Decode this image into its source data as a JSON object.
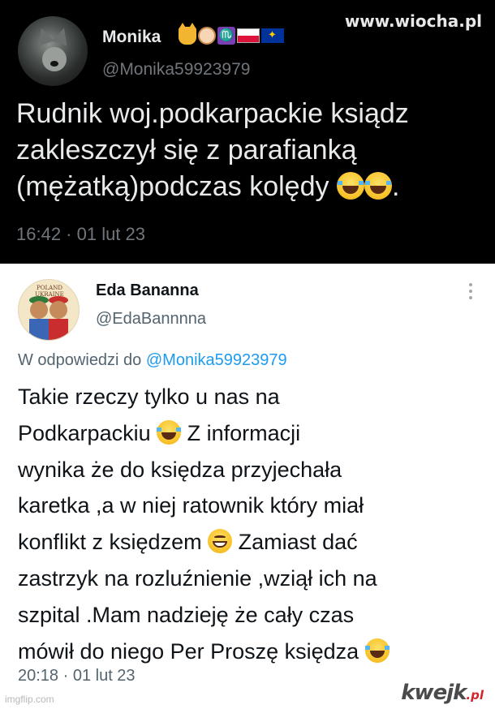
{
  "watermark_top": "www.wiocha.pl",
  "tweet_top": {
    "display_name": "Monika",
    "profile_emojis": [
      "cat-face-icon",
      "dog-face-icon",
      "scorpio-icon",
      "poland-flag-icon",
      "eu-flag-icon"
    ],
    "handle": "@Monika59923979",
    "text_lines": [
      "Rudnik woj.podkarpackie ksiądz",
      "zakleszczył się z parafianką",
      "(mężatką)podczas kolędy"
    ],
    "text_trailing": ".",
    "timestamp": "16:42 · 01 lut 23"
  },
  "tweet_reply": {
    "display_name": "Eda Bananna",
    "avatar_caption": "POLAND UKRAINE",
    "handle": "@EdaBannnna",
    "reply_prefix": "W odpowiedzi do ",
    "reply_mention": "@Monika59923979",
    "text": {
      "l1": "Takie rzeczy tylko u nas na",
      "l2a": "Podkarpackiu ",
      "l2b": " Z informacji",
      "l3": "wynika że do księdza przyjechała",
      "l4": "karetka ,a w niej ratownik który miał",
      "l5a": "konflikt z księdzem ",
      "l5b": " Zamiast dać",
      "l6": "zastrzyk na rozluźnienie ,wziął ich na",
      "l7": "szpital .Mam nadzieję że cały czas",
      "l8": "mówił do niego Per Proszę księdza "
    },
    "timestamp": "20:18 · 01 lut 23"
  },
  "footer": {
    "imgflip": "imgflip.com",
    "kwejk_main": "kwejk",
    "kwejk_tld": ".pl"
  },
  "colors": {
    "dark_bg": "#000000",
    "dark_text": "#e7e9ea",
    "dark_muted": "#71767b",
    "light_text": "#0f1419",
    "light_muted": "#536471",
    "mention": "#1d9bf0"
  }
}
